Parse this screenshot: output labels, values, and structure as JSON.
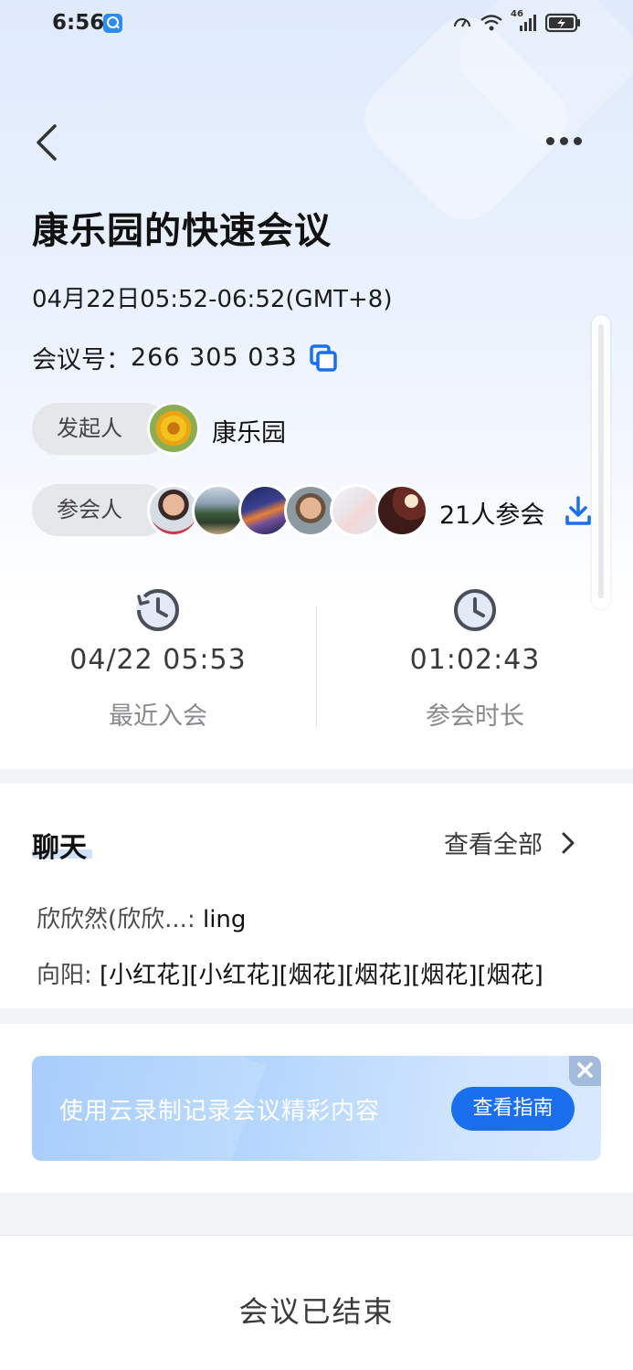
{
  "status_bar": {
    "time": "6:56",
    "network": "46",
    "icons": [
      "search-badge-icon",
      "speed-icon",
      "wifi-icon",
      "signal-icon",
      "battery-icon"
    ]
  },
  "nav": {
    "back_icon": "chevron-left-icon",
    "more_icon": "more-horizontal-icon"
  },
  "meeting": {
    "title": "康乐园的快速会议",
    "time_range": "04月22日05:52-06:52(GMT+8)",
    "id_label": "会议号：",
    "id_value": "266 305 033",
    "initiator_label": "发起人",
    "initiator_name": "康乐园",
    "participants_label": "参会人",
    "participants_count": "21人参会"
  },
  "stats": {
    "last_join": {
      "value": "04/22 05:53",
      "label": "最近入会"
    },
    "duration": {
      "value": "01:02:43",
      "label": "参会时长"
    }
  },
  "chat": {
    "title": "聊天",
    "view_all": "查看全部",
    "messages": [
      {
        "sender": "欣欣然(欣欣...:",
        "text": " ling"
      },
      {
        "sender": "向阳:",
        "text": " [小红花][小红花][烟花][烟花][烟花][烟花]"
      }
    ]
  },
  "banner": {
    "text": "使用云录制记录会议精彩内容",
    "button": "查看指南"
  },
  "footer": {
    "text": "会议已结束"
  },
  "colors": {
    "accent": "#1a6fef",
    "copy_icon": "#1a6fef"
  }
}
